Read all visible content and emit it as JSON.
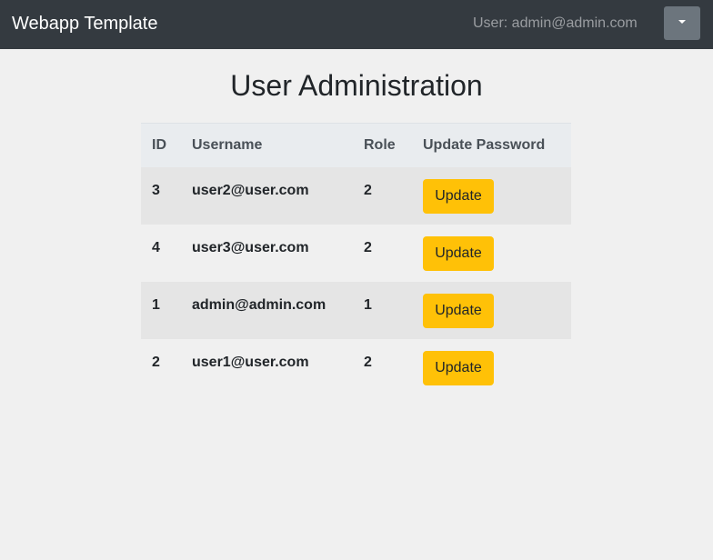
{
  "navbar": {
    "brand": "Webapp Template",
    "user_label": "User: admin@admin.com",
    "dropdown_icon": "caret-down-icon"
  },
  "page": {
    "title": "User Administration"
  },
  "table": {
    "headers": [
      "ID",
      "Username",
      "Role",
      "Update Password"
    ],
    "rows": [
      {
        "id": "3",
        "username": "user2@user.com",
        "role": "2",
        "action": "Update"
      },
      {
        "id": "4",
        "username": "user3@user.com",
        "role": "2",
        "action": "Update"
      },
      {
        "id": "1",
        "username": "admin@admin.com",
        "role": "1",
        "action": "Update"
      },
      {
        "id": "2",
        "username": "user1@user.com",
        "role": "2",
        "action": "Update"
      }
    ]
  },
  "colors": {
    "navbar_bg": "#343a40",
    "page_bg": "#f0f0f0",
    "button_warning": "#ffc107",
    "dropdown_bg": "#6c757d"
  }
}
